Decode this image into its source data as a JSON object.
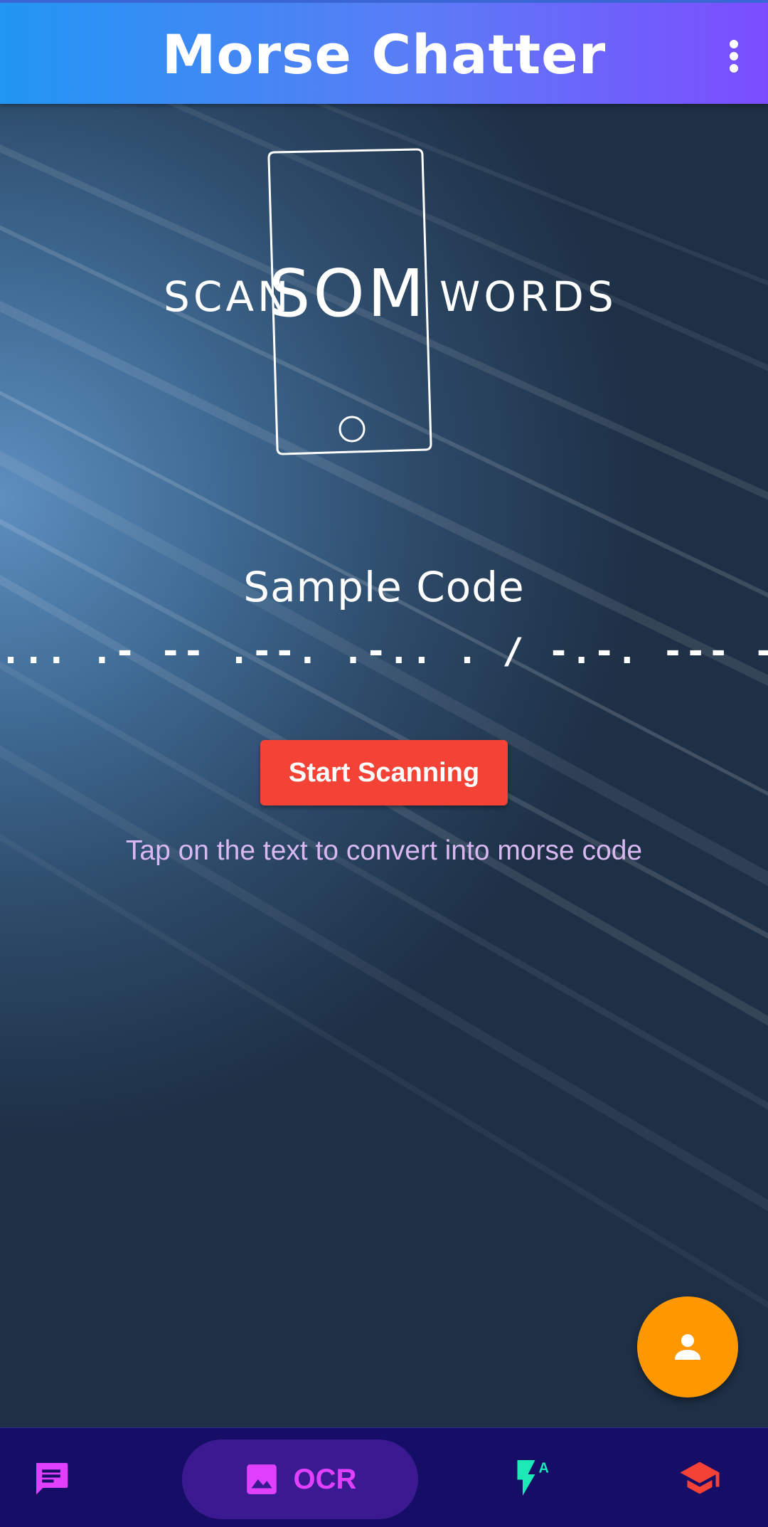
{
  "app_bar": {
    "title": "Morse Chatter",
    "menu_icon": "more-vert-icon"
  },
  "illustration": {
    "text_left": "SCAN",
    "text_middle": "SOME",
    "text_right": "WORDS",
    "icon": "phone-outline-icon"
  },
  "sample": {
    "title": "Sample Code",
    "code": "... .- -- .--. .-.. . / -.-. --- -.. ."
  },
  "actions": {
    "start_label": "Start Scanning",
    "hint": "Tap on the text to convert into morse code"
  },
  "fab": {
    "icon": "person-icon",
    "color": "#ff9800"
  },
  "bottom_nav": {
    "items": [
      {
        "icon": "chat-icon",
        "label": "",
        "color": "#e040fb",
        "selected": false
      },
      {
        "icon": "image-icon",
        "label": "OCR",
        "color": "#e040fb",
        "selected": true
      },
      {
        "icon": "flash-auto-icon",
        "label": "",
        "color": "#1de9b6",
        "selected": false
      },
      {
        "icon": "school-icon",
        "label": "",
        "color": "#f44336",
        "selected": false
      }
    ]
  },
  "colors": {
    "app_bar_start": "#2196f3",
    "app_bar_end": "#7c4dff",
    "start_button": "#f44336",
    "hint_text": "#d9b8f2",
    "bottom_nav_bg": "#160e66"
  }
}
